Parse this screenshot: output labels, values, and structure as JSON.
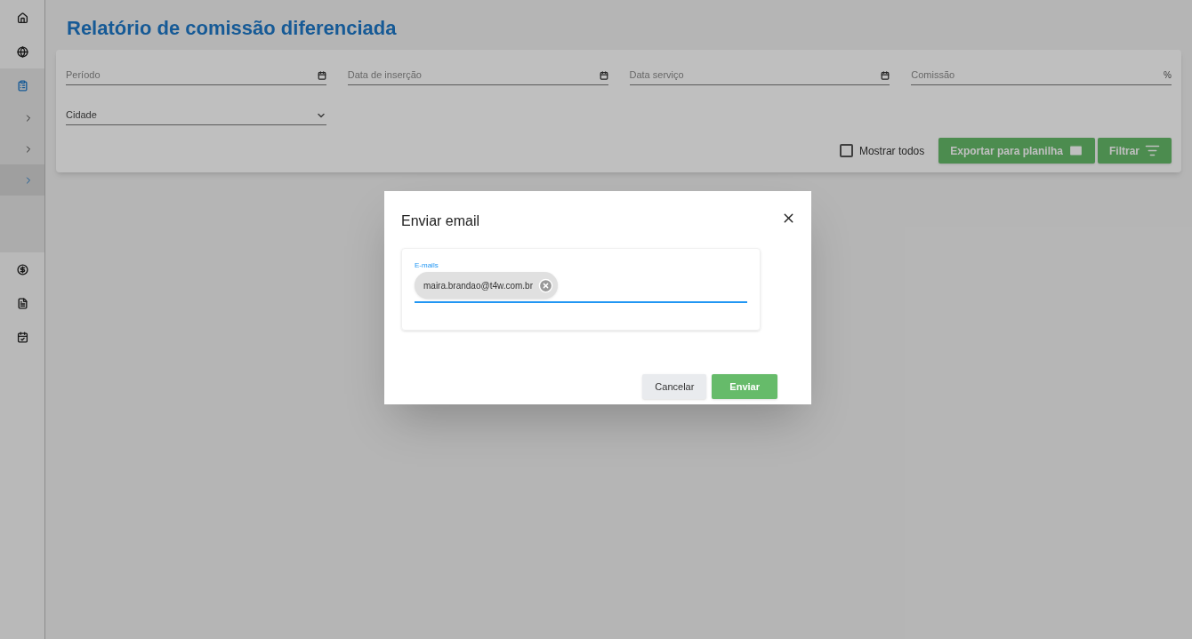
{
  "sidebar": {
    "items": [
      {
        "kind": "home",
        "selected": false
      },
      {
        "kind": "globe",
        "selected": false
      },
      {
        "kind": "clipboard",
        "selected": true
      },
      {
        "kind": "chevron",
        "selected": false
      },
      {
        "kind": "chevron",
        "selected": false
      },
      {
        "kind": "chevron",
        "selected": true
      },
      {
        "kind": "dollar",
        "selected": false
      },
      {
        "kind": "file",
        "selected": false
      },
      {
        "kind": "calendar",
        "selected": false
      }
    ]
  },
  "page": {
    "title": "Relatório de comissão diferenciada"
  },
  "filters": [
    {
      "kind": "date",
      "label": "Período"
    },
    {
      "kind": "date",
      "label": "Data de inserção"
    },
    {
      "kind": "date",
      "label": "Data serviço"
    },
    {
      "kind": "suffix",
      "label": "Comissão",
      "suffix": "%"
    },
    {
      "kind": "select",
      "label": "Cidade"
    }
  ],
  "show_all": {
    "label": "Mostrar todos",
    "checked": false
  },
  "actions": [
    {
      "kind": "export",
      "label": "Exportar para planilha"
    },
    {
      "kind": "filter",
      "label": "Filtrar"
    }
  ],
  "dialog": {
    "title": "Enviar email",
    "field_label": "E-mails",
    "chips": [
      "maira.brandao@t4w.com.br"
    ],
    "cancel": "Cancelar",
    "submit": "Enviar"
  }
}
